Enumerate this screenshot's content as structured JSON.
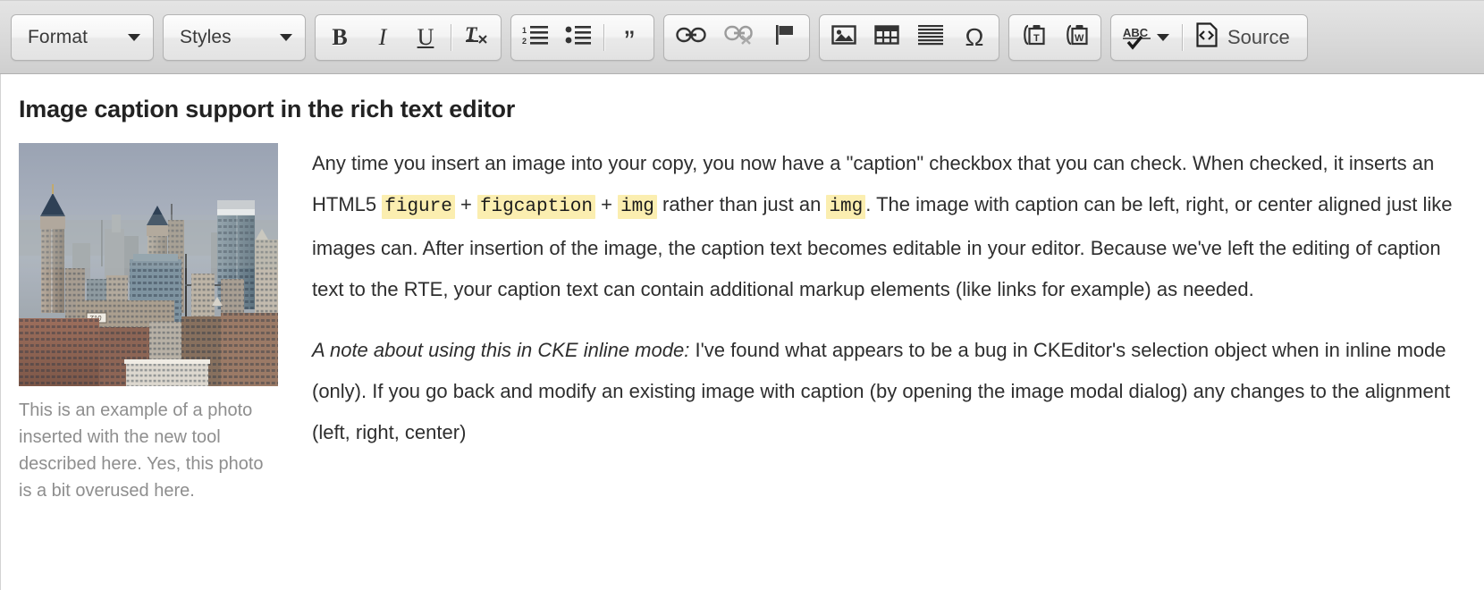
{
  "toolbar": {
    "groups": [
      {
        "name": "format-group",
        "type": "combo",
        "items": [
          {
            "name": "format-combo",
            "label": "Format",
            "icon": "chevron-down-icon"
          }
        ]
      },
      {
        "name": "styles-group",
        "type": "combo",
        "items": [
          {
            "name": "styles-combo",
            "label": "Styles",
            "icon": "chevron-down-icon"
          }
        ]
      },
      {
        "name": "basic-styles-group",
        "type": "buttons",
        "items": [
          {
            "name": "bold-button",
            "icon": "bold-icon",
            "label": "B"
          },
          {
            "name": "italic-button",
            "icon": "italic-icon",
            "label": "I"
          },
          {
            "name": "underline-button",
            "icon": "underline-icon",
            "label": "U"
          },
          {
            "name": "separator",
            "icon": "separator"
          },
          {
            "name": "remove-format-button",
            "icon": "remove-format-icon",
            "label": "Tx"
          }
        ]
      },
      {
        "name": "paragraph-group",
        "type": "buttons",
        "items": [
          {
            "name": "numbered-list-button",
            "icon": "numbered-list-icon"
          },
          {
            "name": "bulleted-list-button",
            "icon": "bulleted-list-icon"
          },
          {
            "name": "separator",
            "icon": "separator"
          },
          {
            "name": "blockquote-button",
            "icon": "blockquote-icon",
            "label": "”"
          }
        ]
      },
      {
        "name": "links-group",
        "type": "buttons",
        "items": [
          {
            "name": "link-button",
            "icon": "link-icon"
          },
          {
            "name": "unlink-button",
            "icon": "unlink-icon"
          },
          {
            "name": "anchor-button",
            "icon": "flag-icon"
          }
        ]
      },
      {
        "name": "insert-group",
        "type": "buttons",
        "items": [
          {
            "name": "image-button",
            "icon": "image-icon"
          },
          {
            "name": "table-button",
            "icon": "table-icon"
          },
          {
            "name": "horizontal-rule-button",
            "icon": "horizontal-rule-icon"
          },
          {
            "name": "special-character-button",
            "icon": "omega-icon",
            "label": "Ω"
          }
        ]
      },
      {
        "name": "clipboard-group",
        "type": "buttons",
        "items": [
          {
            "name": "paste-as-text-button",
            "icon": "paste-text-icon"
          },
          {
            "name": "paste-from-word-button",
            "icon": "paste-word-icon"
          }
        ]
      },
      {
        "name": "tools-group",
        "type": "buttons",
        "items": [
          {
            "name": "spell-check-button",
            "icon": "spellcheck-abc-icon",
            "label": "ABC"
          },
          {
            "name": "separator",
            "icon": "separator"
          },
          {
            "name": "source-button",
            "icon": "source-code-icon",
            "label": "Source"
          }
        ]
      }
    ],
    "labels": {
      "format": "Format",
      "styles": "Styles",
      "bold": "B",
      "italic": "I",
      "underline": "U",
      "remove_format": "T",
      "remove_format_sub": "x",
      "blockquote": "”",
      "omega": "Ω",
      "abc": "ABC",
      "source": "Source"
    }
  },
  "document": {
    "title": "Image caption support in the rich text editor",
    "figure": {
      "image_alt": "city-skyline-photo",
      "caption": "This is an example of a photo inserted with the new tool described here. Yes, this photo is a bit overused here."
    },
    "paragraphs": [
      {
        "name": "paragraph-one",
        "segments": [
          {
            "type": "text",
            "value": "Any time you insert an image into your copy, you now have a \"caption\" checkbox that you can check. When checked, it inserts an HTML5 "
          },
          {
            "type": "code",
            "value": "figure"
          },
          {
            "type": "text",
            "value": " + "
          },
          {
            "type": "code",
            "value": "figcaption"
          },
          {
            "type": "text",
            "value": " + "
          },
          {
            "type": "code",
            "value": "img"
          },
          {
            "type": "text",
            "value": " rather than just an "
          },
          {
            "type": "code",
            "value": "img"
          },
          {
            "type": "text",
            "value": ". The image with caption can be left, right, or center aligned just like images can. After insertion of the image, the caption text becomes editable in your editor. Because we've left the editing of caption text to the RTE, your caption text can contain additional markup elements (like links for example) as needed."
          }
        ]
      },
      {
        "name": "paragraph-two",
        "segments": [
          {
            "type": "emphasis",
            "value": "A note about using this in CKE inline mode:"
          },
          {
            "type": "text",
            "value": " I've found what appears to be a bug in CKEditor's selection object when in inline mode (only). If you go back and modify an existing image with caption (by opening the image modal dialog) any changes to the alignment (left, right, center)"
          }
        ]
      }
    ]
  },
  "colors": {
    "toolbar_bg": "#d9d9d9",
    "toolbar_border": "#b3b3b3",
    "code_highlight": "#fbeeb0",
    "body_text": "#2e2e2e",
    "caption_text": "#8e8e8e",
    "title_text": "#222222"
  }
}
